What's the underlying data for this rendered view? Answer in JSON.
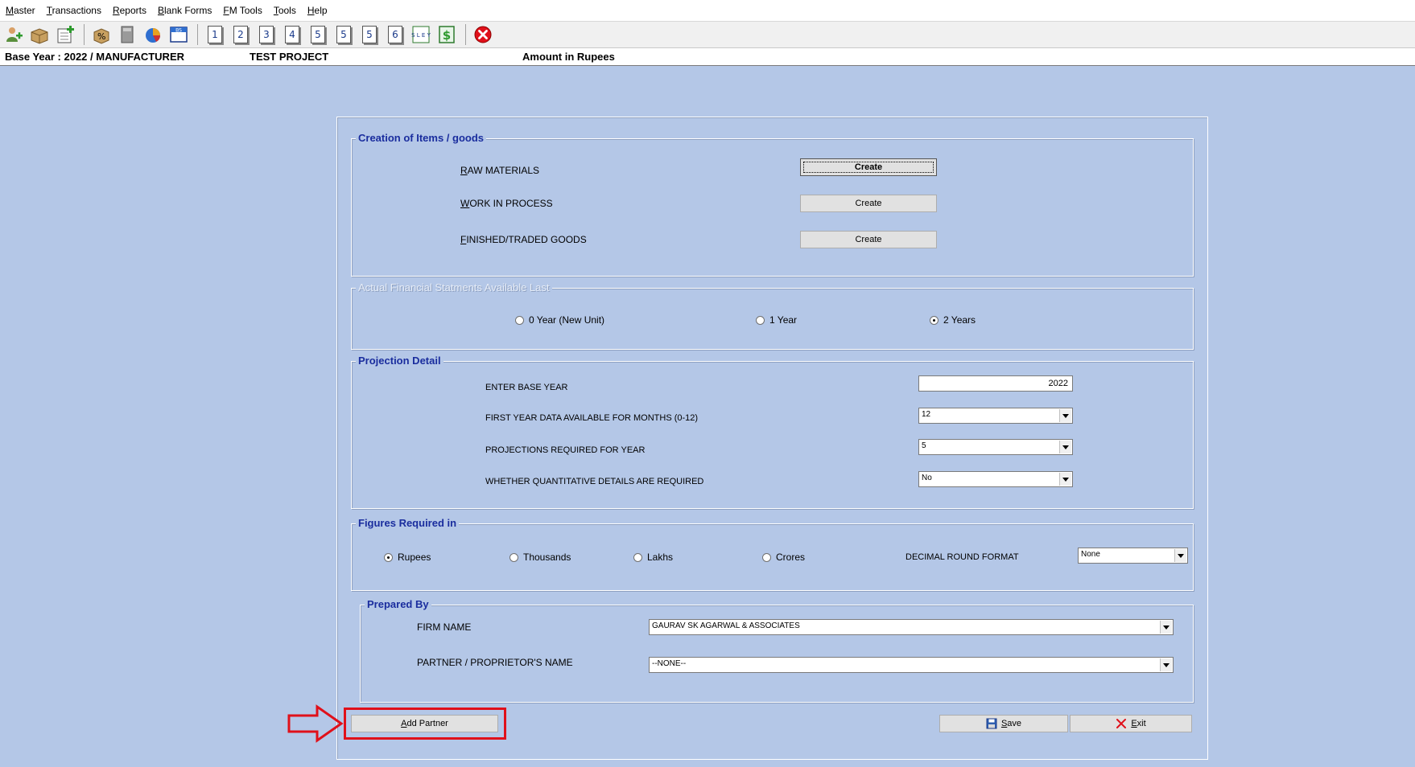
{
  "menu": [
    {
      "mnemonic": "M",
      "rest": "aster"
    },
    {
      "mnemonic": "T",
      "rest": "ransactions"
    },
    {
      "mnemonic": "R",
      "rest": "eports"
    },
    {
      "mnemonic": "B",
      "rest": "lank Forms"
    },
    {
      "mnemonic": "F",
      "rest": "M Tools"
    },
    {
      "mnemonic": "T",
      "rest": "ools"
    },
    {
      "mnemonic": "H",
      "rest": "elp"
    }
  ],
  "toolbar": {
    "numbers": [
      "1",
      "2",
      "3",
      "4",
      "5",
      "5",
      "5",
      "6"
    ],
    "bs_label": "BS",
    "sl_label": "S L E Y",
    "colors": {
      "close": "#e0101a",
      "accent": "#1a2d9e"
    }
  },
  "status": {
    "base_year": "Base Year : 2022 / MANUFACTURER",
    "project": "TEST PROJECT",
    "amount": "Amount in Rupees"
  },
  "items_group": {
    "legend": "Creation of Items / goods",
    "rows": [
      {
        "mnemonic": "R",
        "rest": "AW MATERIALS",
        "button": "Create"
      },
      {
        "mnemonic": "W",
        "rest": "ORK IN PROCESS",
        "button": "Create"
      },
      {
        "mnemonic": "F",
        "rest": "INISHED/TRADED GOODS",
        "button": "Create"
      }
    ]
  },
  "financial_group": {
    "legend": "Actual Financial Statments Available Last",
    "options": [
      {
        "label": "0 Year (New Unit)",
        "selected": false
      },
      {
        "label": "1 Year",
        "selected": false
      },
      {
        "label": "2 Years",
        "selected": true
      }
    ]
  },
  "projection_group": {
    "legend": "Projection Detail",
    "base_year_label": "ENTER BASE YEAR",
    "base_year_value": "2022",
    "months_label": "FIRST YEAR DATA AVAILABLE FOR MONTHS (0-12)",
    "months_value": "12",
    "years_label": "PROJECTIONS REQUIRED FOR  YEAR",
    "years_value": "5",
    "quant_label": "WHETHER QUANTITATIVE DETAILS ARE REQUIRED",
    "quant_value": "No"
  },
  "figures_group": {
    "legend": "Figures Required in",
    "options": [
      {
        "label": "Rupees",
        "selected": true
      },
      {
        "label": "Thousands",
        "selected": false
      },
      {
        "label": "Lakhs",
        "selected": false
      },
      {
        "label": "Crores",
        "selected": false
      }
    ],
    "decimal_label": "DECIMAL ROUND FORMAT",
    "decimal_value": "None"
  },
  "prepared_group": {
    "legend": "Prepared By",
    "firm_label": "FIRM NAME",
    "firm_value": "GAURAV SK AGARWAL & ASSOCIATES",
    "partner_label": "PARTNER / PROPRIETOR'S NAME",
    "partner_value": "--NONE--"
  },
  "buttons": {
    "add_partner": {
      "mnemonic": "A",
      "rest": "dd Partner"
    },
    "save": {
      "mnemonic": "S",
      "rest": "ave"
    },
    "exit": {
      "mnemonic": "E",
      "rest": "xit"
    }
  },
  "annotation": {
    "color": "#e0101a"
  }
}
